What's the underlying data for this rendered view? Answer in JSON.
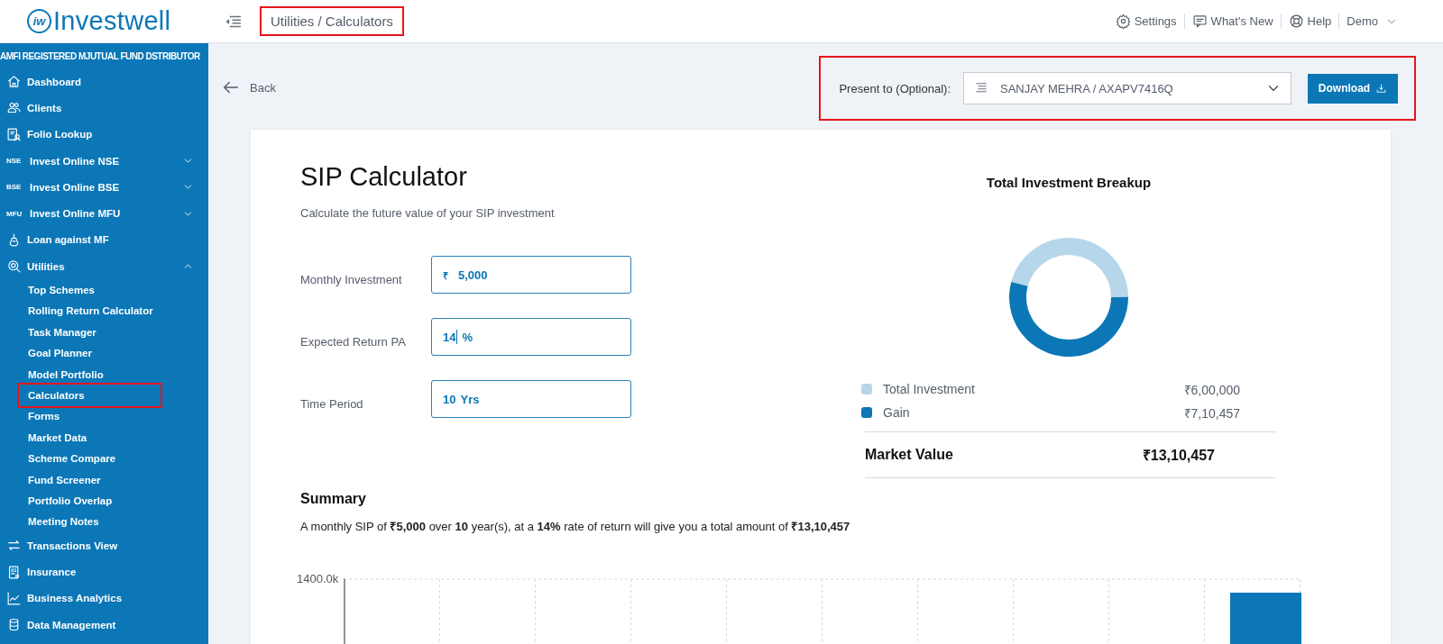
{
  "top_bar": {
    "logo_mark": "iw",
    "logo": "Investwell",
    "breadcrumb": {
      "text": "Utilities / Calculators",
      "highlighted": true
    },
    "links": [
      {
        "label": "Settings"
      },
      {
        "label": "What's New"
      },
      {
        "label": "Help"
      }
    ],
    "user": "Demo"
  },
  "sidebar": {
    "header": "AMFI REGISTERED MJUTUAL FUND DSTRIBUTOR",
    "items": [
      {
        "label": "Dashboard",
        "kind": "link"
      },
      {
        "label": "Clients",
        "kind": "link"
      },
      {
        "label": "Folio Lookup",
        "kind": "link"
      },
      {
        "label": "Invest Online NSE",
        "badge": "NSE",
        "kind": "group",
        "expanded": false
      },
      {
        "label": "Invest Online BSE",
        "badge": "BSE",
        "kind": "group",
        "expanded": false
      },
      {
        "label": "Invest Online MFU",
        "badge": "MFU",
        "kind": "group",
        "expanded": false
      },
      {
        "label": "Loan against MF",
        "kind": "link"
      },
      {
        "label": "Utilities",
        "kind": "group",
        "expanded": true,
        "children": [
          {
            "label": "Top Schemes",
            "highlighted": false
          },
          {
            "label": "Rolling Return Calculator",
            "highlighted": false
          },
          {
            "label": "Task Manager",
            "highlighted": false
          },
          {
            "label": "Goal Planner",
            "highlighted": false
          },
          {
            "label": "Model Portfolio",
            "highlighted": false
          },
          {
            "label": "Calculators",
            "highlighted": true
          },
          {
            "label": "Forms",
            "highlighted": false
          },
          {
            "label": "Market Data",
            "highlighted": false
          },
          {
            "label": "Scheme Compare",
            "highlighted": false
          },
          {
            "label": "Fund Screener",
            "highlighted": false
          },
          {
            "label": "Portfolio Overlap",
            "highlighted": false
          },
          {
            "label": "Meeting Notes",
            "highlighted": false
          }
        ]
      },
      {
        "label": "Transactions View",
        "kind": "link"
      },
      {
        "label": "Insurance",
        "kind": "link"
      },
      {
        "label": "Business Analytics",
        "kind": "link"
      },
      {
        "label": "Data Management",
        "kind": "link"
      }
    ]
  },
  "toolbar": {
    "back": "Back",
    "present_to": {
      "label": "Present to (Optional):",
      "value": "SANJAY MEHRA / AXAPV7416Q",
      "highlighted": true
    },
    "download": "Download"
  },
  "calculator": {
    "title": "SIP Calculator",
    "subtitle": "Calculate the future value of your SIP investment",
    "fields": [
      {
        "label": "Monthly Investment",
        "prefix": "₹",
        "value": "5,000",
        "focused": false
      },
      {
        "label": "Expected Return PA",
        "value": "14",
        "suffix": "%",
        "focused": true
      },
      {
        "label": "Time Period",
        "value": "10",
        "suffix": "Yrs",
        "focused": false
      }
    ],
    "breakup": {
      "chart_data": {
        "type": "donut",
        "title": "Total Investment Breakup",
        "values": [
          45.8,
          54.2
        ]
      },
      "legend": [
        {
          "label": "Total Investment",
          "value": "₹6,00,000",
          "color": "#b6d7ea"
        },
        {
          "label": "Gain",
          "value": "₹7,10,457",
          "color": "#0b77b7"
        }
      ],
      "total": {
        "label": "Market Value",
        "value": "₹13,10,457"
      }
    },
    "summary": {
      "title": "Summary",
      "text": "A monthly SIP of **₹5,000** over **10** year(s), at a **14%** rate of return will give you a total amount of **₹13,10,457**"
    },
    "growth_chart": {
      "y_tick": "1400.0k"
    }
  }
}
